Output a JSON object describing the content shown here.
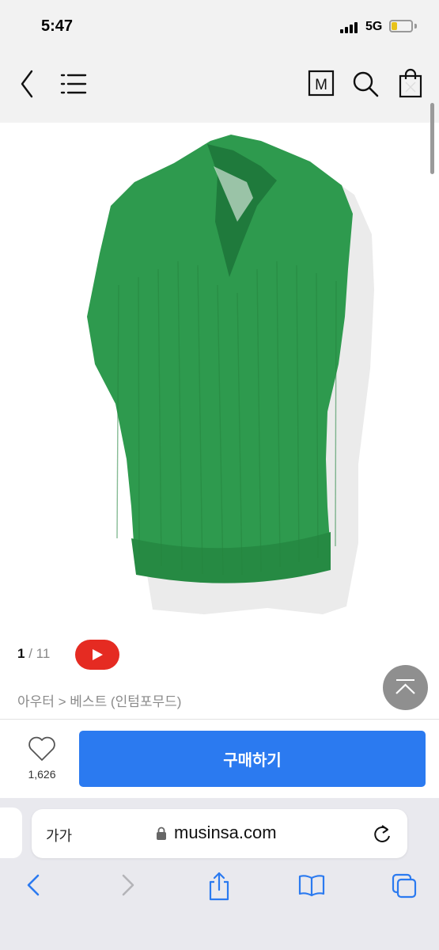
{
  "status_bar": {
    "time": "5:47",
    "network": "5G",
    "battery_level": 0.3
  },
  "header": {
    "icons": [
      "back-icon",
      "menu-icon",
      "musinsa-m-logo-icon",
      "search-icon",
      "shopping-bag-icon"
    ],
    "m_logo_text": "M"
  },
  "product": {
    "image": "green-knit-v-neck-vest",
    "accent_color": "#2e9a4e"
  },
  "gallery": {
    "current": "1",
    "separator": "/",
    "total": "11"
  },
  "video_button": {
    "icon": "youtube-play-icon",
    "color": "#e52b22"
  },
  "breadcrumb": {
    "text": "아우터 > 베스트 (인텀포무드)"
  },
  "purchase": {
    "like_count": "1,626",
    "buy_label": "구매하기",
    "buy_color": "#2b7af0"
  },
  "browser": {
    "text_size_label": "가가",
    "url": "musinsa.com",
    "toolbar_icons": [
      "browser-back-icon",
      "browser-forward-icon",
      "share-icon",
      "bookmarks-icon",
      "tabs-icon"
    ]
  }
}
